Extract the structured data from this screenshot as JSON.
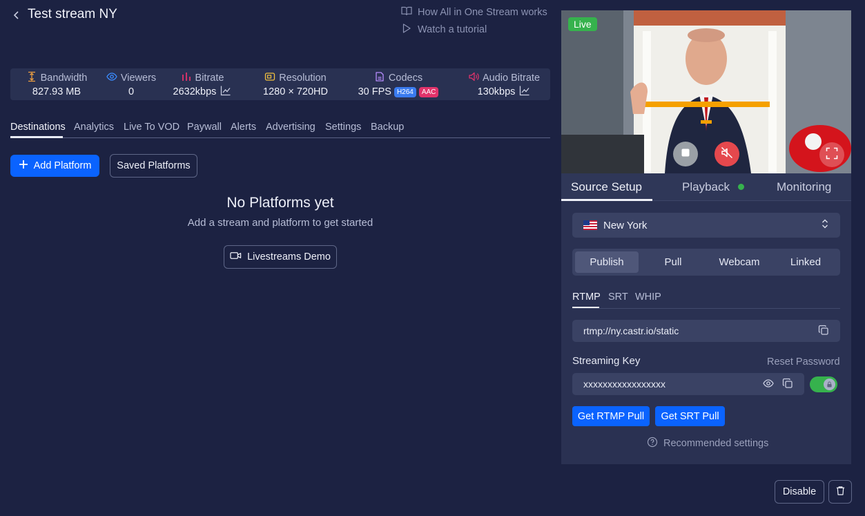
{
  "header": {
    "title": "Test stream NY",
    "help_link": "How All in One Stream works",
    "tutorial_link": "Watch a tutorial"
  },
  "stats": {
    "bandwidth": {
      "label": "Bandwidth",
      "value": "827.93 MB"
    },
    "viewers": {
      "label": "Viewers",
      "value": "0"
    },
    "bitrate": {
      "label": "Bitrate",
      "value": "2632kbps"
    },
    "resolution": {
      "label": "Resolution",
      "value": "1280 × 720HD"
    },
    "codecs": {
      "label": "Codecs",
      "value": "30 FPS",
      "video_codec": "H264",
      "audio_codec": "AAC"
    },
    "audio_bitrate": {
      "label": "Audio Bitrate",
      "value": "130kbps"
    }
  },
  "tabs": [
    "Destinations",
    "Analytics",
    "Live To VOD",
    "Paywall",
    "Alerts",
    "Advertising",
    "Settings",
    "Backup"
  ],
  "actions": {
    "add_platform": "Add Platform",
    "saved_platforms": "Saved Platforms"
  },
  "empty_state": {
    "title": "No Platforms yet",
    "subtitle": "Add a stream and platform to get started",
    "demo_button": "Livestreams Demo"
  },
  "player": {
    "status": "Live"
  },
  "panel_tabs": [
    "Source Setup",
    "Playback",
    "Monitoring"
  ],
  "region": {
    "selected": "New York"
  },
  "source_modes": [
    "Publish",
    "Pull",
    "Webcam",
    "Linked"
  ],
  "protocols": [
    "RTMP",
    "SRT",
    "WHIP"
  ],
  "rtmp": {
    "server_url": "rtmp://ny.castr.io/static",
    "key_label": "Streaming Key",
    "reset_label": "Reset Password",
    "key_value": "xxxxxxxxxxxxxxxxx",
    "rtmp_pull_button": "Get RTMP Pull",
    "srt_pull_button": "Get SRT Pull",
    "recommended": "Recommended settings"
  },
  "footer": {
    "disable_button": "Disable"
  },
  "colors": {
    "background": "#1c2242",
    "accent": "#0a63ff",
    "live": "#36b24d",
    "h264_badge": "#3a7bef",
    "aac_badge": "#e2336b"
  }
}
